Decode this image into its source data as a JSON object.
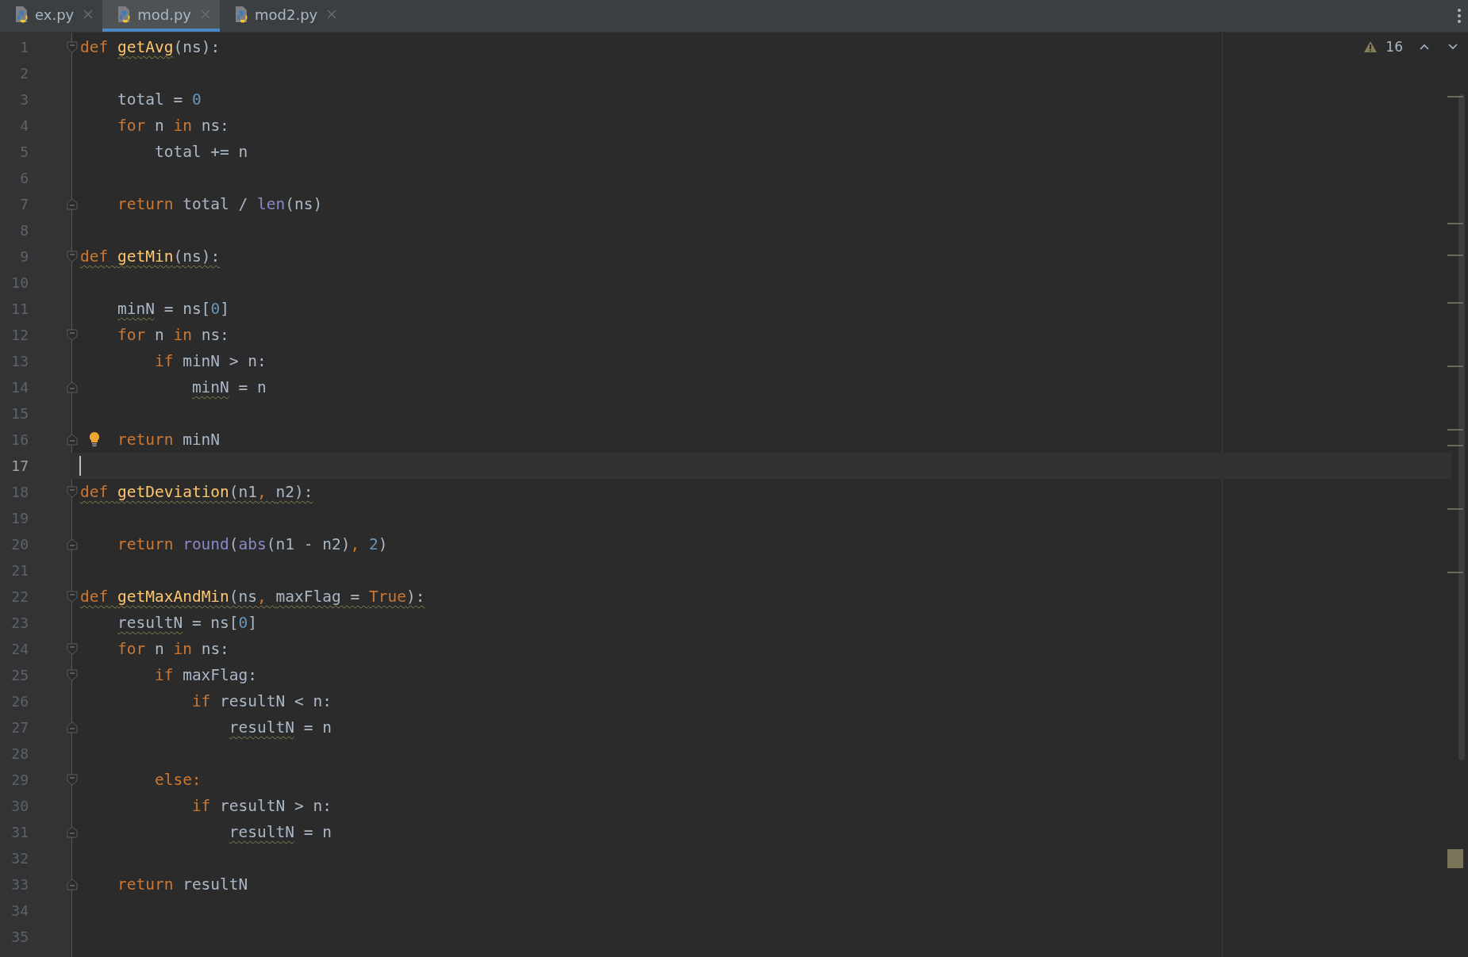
{
  "tabs": [
    {
      "label": "ex.py",
      "selected": false
    },
    {
      "label": "mod.py",
      "selected": true
    },
    {
      "label": "mod2.py",
      "selected": false
    }
  ],
  "inspections": {
    "warnings": "16"
  },
  "lines": [
    {
      "number": "1",
      "fold_start": true,
      "tokens": [
        {
          "kind": "kw",
          "text": "def "
        },
        {
          "kind": "fn",
          "text": "getAvg",
          "warn": true
        },
        {
          "kind": "plain",
          "text": "(ns):"
        }
      ],
      "children": [
        {
          "number": "2"
        },
        {
          "number": "3",
          "tokens": [
            {
              "kind": "plain",
              "text": "total = "
            },
            {
              "kind": "num",
              "text": "0"
            }
          ]
        },
        {
          "number": "4",
          "tokens": [
            {
              "kind": "kw",
              "text": "for "
            },
            {
              "kind": "plain",
              "text": "n "
            },
            {
              "kind": "kw",
              "text": "in "
            },
            {
              "kind": "plain",
              "text": "ns:"
            }
          ],
          "children": [
            {
              "number": "5",
              "tokens": [
                {
                  "kind": "plain",
                  "text": "total += n"
                }
              ]
            }
          ]
        },
        {
          "number": "6"
        },
        {
          "number": "7",
          "fold_end": true,
          "tokens": [
            {
              "kind": "kw",
              "text": "return "
            },
            {
              "kind": "plain",
              "text": "total / "
            },
            {
              "kind": "builtin",
              "text": "len"
            },
            {
              "kind": "plain",
              "text": "(ns)"
            }
          ]
        }
      ]
    },
    {
      "number": "8"
    },
    {
      "number": "9",
      "fold_start": true,
      "tokens": [
        {
          "kind": "kw",
          "text": "def ",
          "warn": true
        },
        {
          "kind": "fn",
          "text": "getMin",
          "warn": true
        },
        {
          "kind": "plain",
          "text": "(ns):",
          "warn": true
        }
      ],
      "children": [
        {
          "number": "10"
        },
        {
          "number": "11",
          "tokens": [
            {
              "kind": "plain",
              "text": "minN",
              "warn": true
            },
            {
              "kind": "plain",
              "text": " = ns["
            },
            {
              "kind": "num",
              "text": "0"
            },
            {
              "kind": "plain",
              "text": "]"
            }
          ]
        },
        {
          "number": "12",
          "fold_start": true,
          "tokens": [
            {
              "kind": "kw",
              "text": "for "
            },
            {
              "kind": "plain",
              "text": "n "
            },
            {
              "kind": "kw",
              "text": "in "
            },
            {
              "kind": "plain",
              "text": "ns:"
            }
          ],
          "children": [
            {
              "number": "13",
              "tokens": [
                {
                  "kind": "kw",
                  "text": "if "
                },
                {
                  "kind": "plain",
                  "text": "minN > n:"
                }
              ],
              "children": [
                {
                  "number": "14",
                  "fold_end": true,
                  "tokens": [
                    {
                      "kind": "plain",
                      "text": "minN",
                      "warn": true
                    },
                    {
                      "kind": "plain",
                      "text": " = n"
                    }
                  ]
                }
              ]
            }
          ]
        },
        {
          "number": "15"
        },
        {
          "number": "16",
          "fold_end": true,
          "hint": true,
          "tokens": [
            {
              "kind": "kw",
              "text": "return "
            },
            {
              "kind": "plain",
              "text": "minN"
            }
          ]
        }
      ]
    },
    {
      "number": "17",
      "current": true
    },
    {
      "number": "18",
      "fold_start": true,
      "tokens": [
        {
          "kind": "kw",
          "text": "def ",
          "warn": true
        },
        {
          "kind": "fn",
          "text": "getDeviation",
          "warn": true
        },
        {
          "kind": "plain",
          "text": "(n1",
          "warn": true
        },
        {
          "kind": "kw",
          "text": ", ",
          "warn": true
        },
        {
          "kind": "plain",
          "text": "n2):",
          "warn": true
        }
      ],
      "children": [
        {
          "number": "19"
        },
        {
          "number": "20",
          "fold_end": true,
          "tokens": [
            {
              "kind": "kw",
              "text": "return "
            },
            {
              "kind": "builtin",
              "text": "round"
            },
            {
              "kind": "plain",
              "text": "("
            },
            {
              "kind": "builtin",
              "text": "abs"
            },
            {
              "kind": "plain",
              "text": "(n1 - n2)"
            },
            {
              "kind": "kw",
              "text": ", "
            },
            {
              "kind": "num",
              "text": "2"
            },
            {
              "kind": "plain",
              "text": ")"
            }
          ]
        }
      ]
    },
    {
      "number": "21"
    },
    {
      "number": "22",
      "fold_start": true,
      "tokens": [
        {
          "kind": "kw",
          "text": "def ",
          "warn": true
        },
        {
          "kind": "fn",
          "text": "getMaxAndMin",
          "warn": true
        },
        {
          "kind": "plain",
          "text": "(ns",
          "warn": true
        },
        {
          "kind": "kw",
          "text": ", ",
          "warn": true
        },
        {
          "kind": "plain",
          "text": "maxFlag = ",
          "warn": true
        },
        {
          "kind": "kw",
          "text": "True",
          "warn": true
        },
        {
          "kind": "plain",
          "text": "):",
          "warn": true
        }
      ],
      "children": [
        {
          "number": "23",
          "tokens": [
            {
              "kind": "plain",
              "text": "resultN",
              "warn": true
            },
            {
              "kind": "plain",
              "text": " = ns["
            },
            {
              "kind": "num",
              "text": "0"
            },
            {
              "kind": "plain",
              "text": "]"
            }
          ]
        },
        {
          "number": "24",
          "fold_start": true,
          "tokens": [
            {
              "kind": "kw",
              "text": "for "
            },
            {
              "kind": "plain",
              "text": "n "
            },
            {
              "kind": "kw",
              "text": "in "
            },
            {
              "kind": "plain",
              "text": "ns:"
            }
          ],
          "children": [
            {
              "number": "25",
              "fold_start": true,
              "tokens": [
                {
                  "kind": "kw",
                  "text": "if "
                },
                {
                  "kind": "plain",
                  "text": "maxFlag:"
                }
              ],
              "children": [
                {
                  "number": "26",
                  "tokens": [
                    {
                      "kind": "kw",
                      "text": "if "
                    },
                    {
                      "kind": "plain",
                      "text": "resultN < n:"
                    }
                  ],
                  "children": [
                    {
                      "number": "27",
                      "fold_end": true,
                      "tokens": [
                        {
                          "kind": "plain",
                          "text": "resultN",
                          "warn": true
                        },
                        {
                          "kind": "plain",
                          "text": " = n"
                        }
                      ]
                    }
                  ]
                },
                {
                  "number": "28"
                }
              ]
            },
            {
              "number": "29",
              "fold_start": true,
              "tokens": [
                {
                  "kind": "kw",
                  "text": "else:"
                }
              ],
              "children": [
                {
                  "number": "30",
                  "tokens": [
                    {
                      "kind": "kw",
                      "text": "if "
                    },
                    {
                      "kind": "plain",
                      "text": "resultN > n:"
                    }
                  ],
                  "children": [
                    {
                      "number": "31",
                      "fold_end": true,
                      "tokens": [
                        {
                          "kind": "plain",
                          "text": "resultN",
                          "warn": true
                        },
                        {
                          "kind": "plain",
                          "text": " = n"
                        }
                      ]
                    }
                  ]
                }
              ]
            }
          ]
        },
        {
          "number": "32"
        },
        {
          "number": "33",
          "fold_end": true,
          "tokens": [
            {
              "kind": "kw",
              "text": "return "
            },
            {
              "kind": "plain",
              "text": "resultN"
            }
          ]
        }
      ]
    },
    {
      "number": "34"
    },
    {
      "number": "35"
    }
  ]
}
